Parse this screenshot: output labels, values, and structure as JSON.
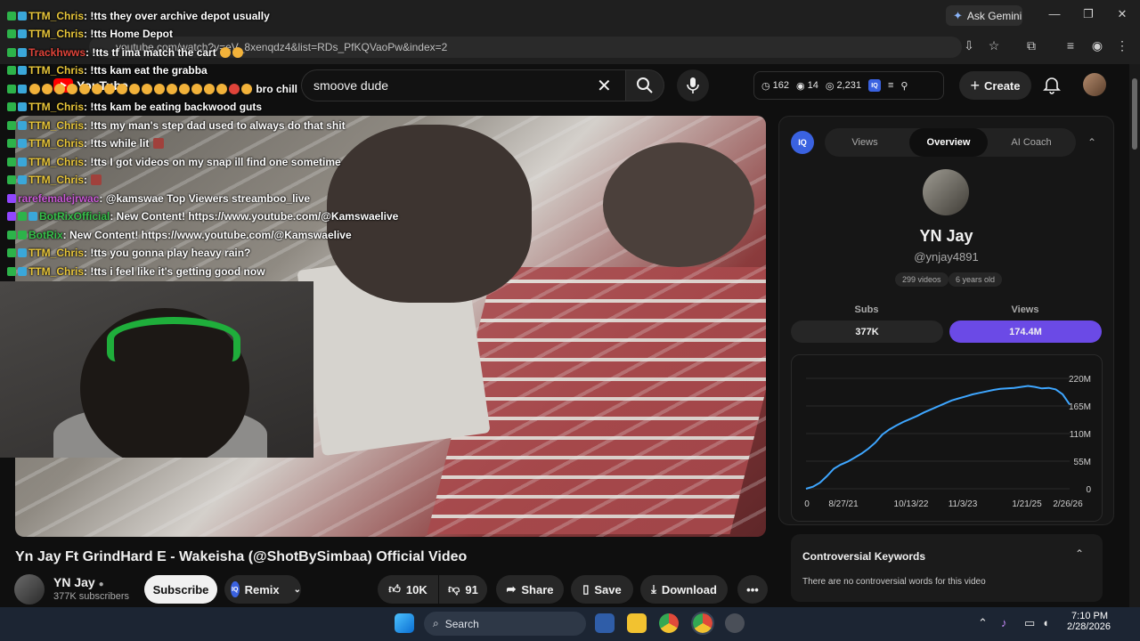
{
  "browser": {
    "url": "youtube.com/watch?v=eV_8xenqdz4&list=RDs_PfKQVaoPw&index=2",
    "ask_gemini": "Ask Gemini"
  },
  "youtube": {
    "logo_text": "YouTube",
    "search_value": "smoove dude",
    "stats": {
      "a": "162",
      "b": "14",
      "c": "2,231"
    },
    "create_label": "Create"
  },
  "chat": [
    {
      "user": "TTM_Chris",
      "msg": ": !tts they over archive depot usually"
    },
    {
      "user": "TTM_Chris",
      "msg": ": !tts Home Depot"
    },
    {
      "user": "Trackhwws",
      "msg": ": !tts tf ima match the cart"
    },
    {
      "user": "TTM_Chris",
      "msg": ": !tts kam eat the grabba"
    },
    {
      "user": "",
      "msg": "bro chill"
    },
    {
      "user": "TTM_Chris",
      "msg": ": !tts kam be eating backwood guts"
    },
    {
      "user": "TTM_Chris",
      "msg": ": !tts my man's step dad used to always do that shit"
    },
    {
      "user": "TTM_Chris",
      "msg": ": !tts while lit"
    },
    {
      "user": "TTM_Chris",
      "msg": ": !tts I got videos on my snap ill find one sometime"
    },
    {
      "user": "TTM_Chris",
      "msg": ":"
    },
    {
      "user": "rarefemalejrwac",
      "msg": ": @kamswae Top Viewers streamboo_live"
    },
    {
      "user": "BotRixOfficial",
      "msg": ": New Content! https://www.youtube.com/@Kamswaelive"
    },
    {
      "user": "BotRix",
      "msg": ": New Content! https://www.youtube.com/@Kamswaelive"
    },
    {
      "user": "TTM_Chris",
      "msg": ": !tts you gonna play heavy rain?"
    },
    {
      "user": "TTM_Chris",
      "msg": ": !tts i feel like it's getting good now"
    }
  ],
  "video": {
    "title": "Yn Jay Ft GrindHard E - Wakeisha (@ShotBySimbaa) Official Video",
    "channel": "YN Jay",
    "subscribers": "377K subscribers",
    "subscribe": "Subscribe",
    "remix": "Remix",
    "likes": "10K",
    "dislikes": "91",
    "share": "Share",
    "save": "Save",
    "download": "Download"
  },
  "panel": {
    "tabs": [
      "Views",
      "Overview",
      "AI Coach"
    ],
    "name": "YN Jay",
    "handle": "@ynjay4891",
    "videos": "299 videos",
    "age": "6 years old",
    "subs_label": "Subs",
    "subs_value": "377K",
    "views_label": "Views",
    "views_value": "174.4M",
    "controversial_title": "Controversial Keywords",
    "controversial_text": "There are no controversial words for this video"
  },
  "chart_data": {
    "type": "line",
    "x_ticks": [
      "0",
      "8/27/21",
      "10/13/22",
      "11/3/23",
      "1/21/25",
      "2/26/26"
    ],
    "y_ticks": [
      "0",
      "55M",
      "110M",
      "165M",
      "220M"
    ],
    "ylim": [
      0,
      220
    ],
    "series": [
      {
        "values": [
          0,
          4,
          12,
          25,
          40,
          48,
          54,
          62,
          70,
          80,
          92,
          108,
          118,
          126,
          133,
          139,
          145,
          152,
          158,
          164,
          170,
          176,
          180,
          184,
          188,
          191,
          194,
          197,
          199,
          200,
          201,
          203,
          205,
          203,
          200,
          201,
          198,
          188,
          168
        ]
      }
    ],
    "color": "#3ea6ff"
  },
  "taskbar": {
    "search": "Search",
    "time": "7:10 PM",
    "date": "2/28/2026"
  }
}
